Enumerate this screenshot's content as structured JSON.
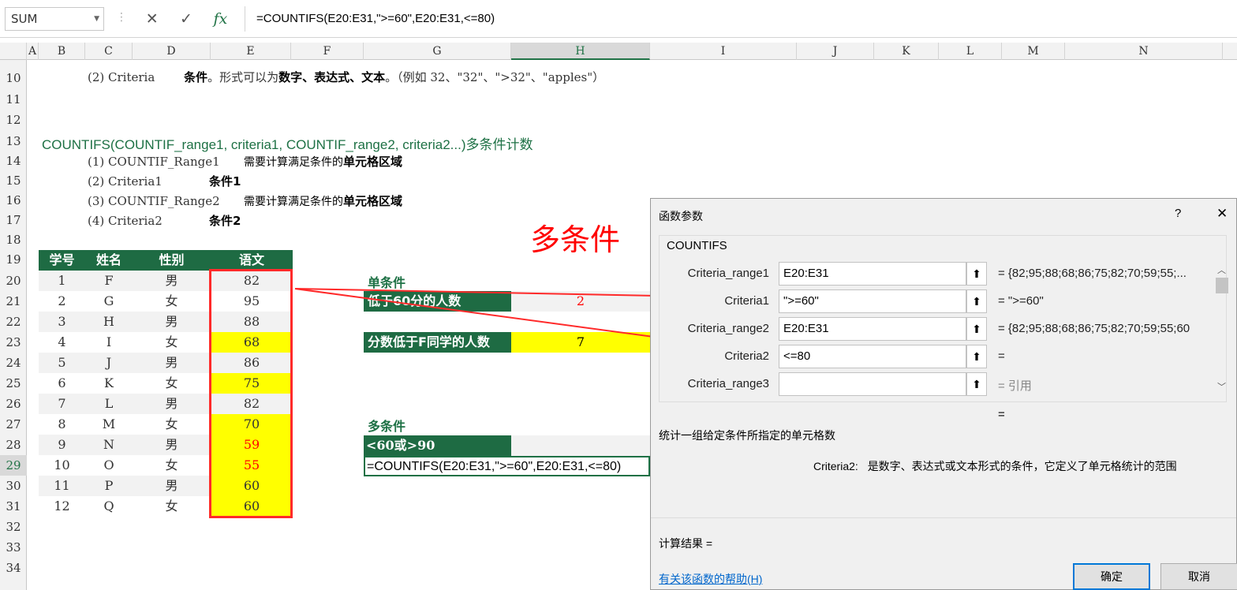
{
  "formula_bar": {
    "name_box": "SUM",
    "cancel_icon": "✕",
    "enter_icon": "✓",
    "fx_icon": "fx",
    "formula": "=COUNTIFS(E20:E31,\">=60\",E20:E31,<=80)"
  },
  "columns": [
    "A",
    "B",
    "C",
    "D",
    "E",
    "F",
    "G",
    "H",
    "I",
    "J",
    "K",
    "L",
    "M",
    "N"
  ],
  "rows": [
    "10",
    "11",
    "12",
    "13",
    "14",
    "15",
    "16",
    "17",
    "18",
    "19",
    "20",
    "21",
    "22",
    "23",
    "24",
    "25",
    "26",
    "27",
    "28",
    "29",
    "30",
    "31",
    "32",
    "33",
    "34"
  ],
  "notes": {
    "r10_label": "(2) Criteria",
    "r10_desc_bold1": "条件",
    "r10_desc_text1": "。形式可以为",
    "r10_desc_bold2": "数字、表达式、文本",
    "r10_desc_text2": "。（例如 32、\"32\"、\">32\"、\"apples\"）",
    "r13_title": "COUNTIFS(COUNTIF_range1, criteria1, COUNTIF_range2, criteria2...)多条件计数",
    "r14_label": "(1) COUNTIF_Range1",
    "r14_desc": "需要计算满足条件的",
    "r14_bold": "单元格区域",
    "r15_label": "(2) Criteria1",
    "r15_bold": "条件1",
    "r16_label": "(3) COUNTIF_Range2",
    "r16_desc": "需要计算满足条件的",
    "r16_bold": "单元格区域",
    "r17_label": "(4) Criteria2",
    "r17_bold": "条件2"
  },
  "big_label": "多条件",
  "table": {
    "headers": [
      "学号",
      "姓名",
      "性别",
      "语文"
    ],
    "rows": [
      {
        "id": "1",
        "name": "F",
        "sex": "男",
        "score": "82",
        "highlight": false,
        "red": false
      },
      {
        "id": "2",
        "name": "G",
        "sex": "女",
        "score": "95",
        "highlight": false,
        "red": false
      },
      {
        "id": "3",
        "name": "H",
        "sex": "男",
        "score": "88",
        "highlight": false,
        "red": false
      },
      {
        "id": "4",
        "name": "I",
        "sex": "女",
        "score": "68",
        "highlight": true,
        "red": false
      },
      {
        "id": "5",
        "name": "J",
        "sex": "男",
        "score": "86",
        "highlight": false,
        "red": false
      },
      {
        "id": "6",
        "name": "K",
        "sex": "女",
        "score": "75",
        "highlight": true,
        "red": false
      },
      {
        "id": "7",
        "name": "L",
        "sex": "男",
        "score": "82",
        "highlight": false,
        "red": false
      },
      {
        "id": "8",
        "name": "M",
        "sex": "女",
        "score": "70",
        "highlight": true,
        "red": false
      },
      {
        "id": "9",
        "name": "N",
        "sex": "男",
        "score": "59",
        "highlight": true,
        "red": true
      },
      {
        "id": "10",
        "name": "O",
        "sex": "女",
        "score": "55",
        "highlight": true,
        "red": true
      },
      {
        "id": "11",
        "name": "P",
        "sex": "男",
        "score": "60",
        "highlight": true,
        "red": false
      },
      {
        "id": "12",
        "name": "Q",
        "sex": "女",
        "score": "60",
        "highlight": true,
        "red": false
      }
    ]
  },
  "single": {
    "title": "单条件",
    "q1": "低于60分的人数",
    "a1": "2",
    "q2": "分数低于F同学的人数",
    "a2": "7"
  },
  "multi": {
    "title": "多条件",
    "label": "<60或>90",
    "edit": "=COUNTIFS(E20:E31,\">=60\",E20:E31,<=80)"
  },
  "dialog": {
    "title": "函数参数",
    "help_q": "?",
    "close": "✕",
    "func": "COUNTIFS",
    "args": [
      {
        "label": "Criteria_range1",
        "value": "E20:E31",
        "result": "= {82;95;88;68;86;75;82;70;59;55;..."
      },
      {
        "label": "Criteria1",
        "value": "\">=60\"",
        "result": "= \">=60\""
      },
      {
        "label": "Criteria_range2",
        "value": "E20:E31",
        "result": "= {82;95;88;68;86;75;82;70;59;55;60"
      },
      {
        "label": "Criteria2",
        "value": "<=80",
        "result": "="
      },
      {
        "label": "Criteria_range3",
        "value": "",
        "result": "= 引用"
      }
    ],
    "eq": "=",
    "desc": "统计一组给定条件所指定的单元格数",
    "arg_name": "Criteria2:",
    "arg_desc": "是数字、表达式或文本形式的条件，它定义了单元格统计的范围",
    "calc": "计算结果 =",
    "help_link": "有关该函数的帮助(H)",
    "ok": "确定",
    "cancel": "取消"
  },
  "colors": {
    "header_green": "#1e6b43",
    "highlight": "#ffff00",
    "annotation": "#ff0000"
  }
}
